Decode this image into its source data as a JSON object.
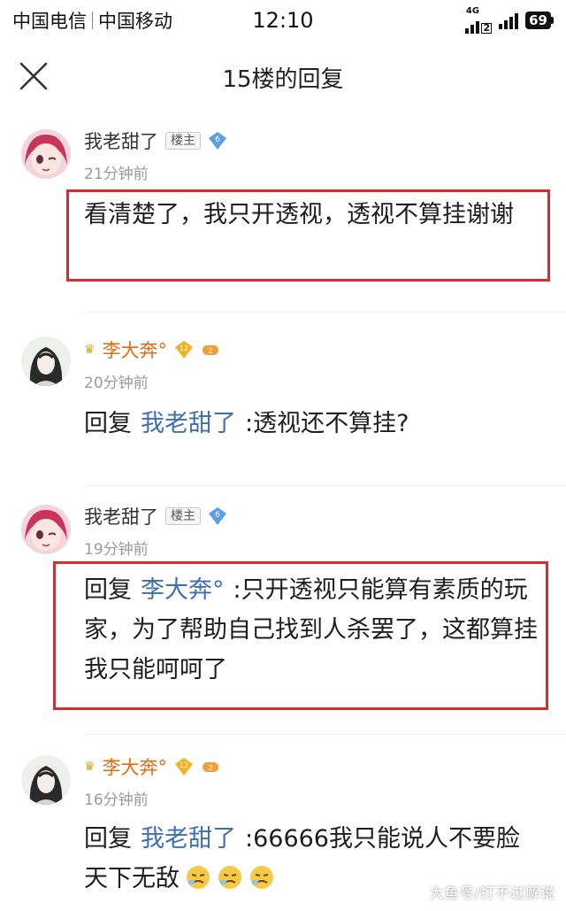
{
  "status_bar": {
    "carrier_1": "中国电信",
    "carrier_2": "中国移动",
    "time": "12:10",
    "network_label_top": "4G",
    "network_label_sub": "2",
    "battery": "69"
  },
  "header": {
    "title": "15楼的回复",
    "close_icon": "close-icon"
  },
  "comments": [
    {
      "username": "我老甜了",
      "badge": "楼主",
      "level": "6",
      "time": "21分钟前",
      "text": "看清楚了，我只开透视，透视不算挂谢谢"
    },
    {
      "username": "李大奔°",
      "level": "12",
      "extra_badge": "2",
      "time": "20分钟前",
      "reply_prefix": "回复",
      "mention": "我老甜了",
      "text": ":透视还不算挂?"
    },
    {
      "username": "我老甜了",
      "badge": "楼主",
      "level": "6",
      "time": "19分钟前",
      "reply_prefix": "回复",
      "mention": "李大奔°",
      "text": ":只开透视只能算有素质的玩家，为了帮助自己找到人杀罢了，这都算挂我只能呵呵了"
    },
    {
      "username": "李大奔°",
      "level": "12",
      "extra_badge": "2",
      "time": "16分钟前",
      "reply_prefix": "回复",
      "mention": "我老甜了",
      "text": ":66666我只能说人不要脸天下无敌"
    }
  ],
  "watermark": "大鱼号/打不过解说",
  "colors": {
    "highlight_border": "#d42d2d",
    "mention": "#3d6fb2",
    "time_text": "#9a9a9a",
    "gold_name": "#e26b12"
  }
}
